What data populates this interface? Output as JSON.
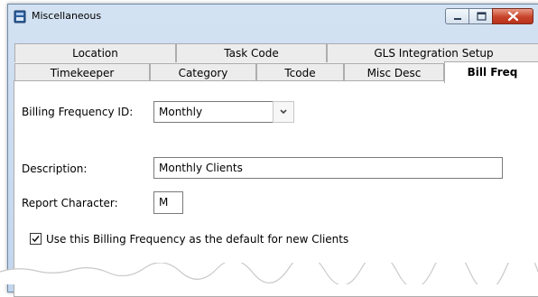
{
  "window": {
    "title": "Miscellaneous",
    "icon": "app-icon",
    "controls": [
      "minimize-icon",
      "maximize-icon",
      "close-icon"
    ],
    "close_color": "#c8432a"
  },
  "tabs": {
    "row1": [
      {
        "label": "Location"
      },
      {
        "label": "Task Code"
      },
      {
        "label": "GLS Integration Setup"
      }
    ],
    "row2": [
      {
        "label": "Timekeeper"
      },
      {
        "label": "Category"
      },
      {
        "label": "Tcode"
      },
      {
        "label": "Misc Desc"
      },
      {
        "label": "Bill Freq"
      }
    ],
    "selected": "Bill Freq"
  },
  "form": {
    "billing_frequency_id": {
      "label": "Billing Frequency ID:",
      "value": "Monthly",
      "dropdown_icon": "chevron-down-icon"
    },
    "description": {
      "label": "Description:",
      "value": "Monthly Clients"
    },
    "report_character": {
      "label": "Report Character:",
      "value": "M"
    },
    "default_checkbox": {
      "label": "Use this Billing Frequency as the default for new Clients",
      "checked": true
    }
  }
}
